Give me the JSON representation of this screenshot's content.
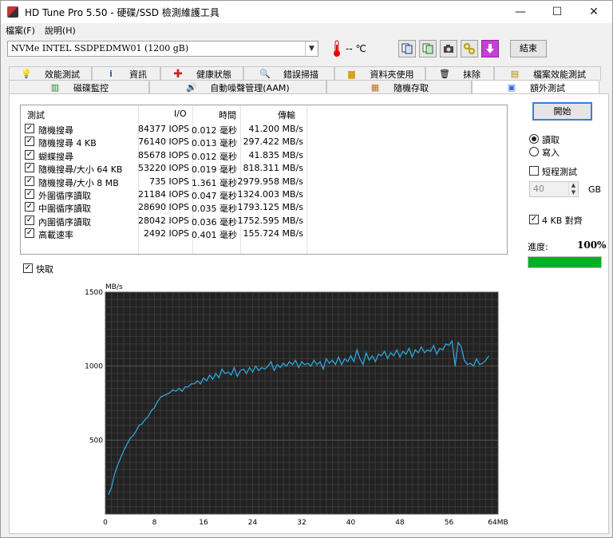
{
  "window": {
    "title": "HD Tune Pro 5.50 - 硬碟/SSD 檢測維護工具",
    "minimize": "—",
    "maximize": "☐",
    "close": "✕"
  },
  "menu": {
    "file": "檔案(F)",
    "help": "說明(H)"
  },
  "toolbar": {
    "drive": "NVMe   INTEL SSDPEDMW01 (1200 gB)",
    "temperature": "-- ℃",
    "exit_label": "結束"
  },
  "tabs_top": [
    {
      "label": "效能測試",
      "icon": "lightbulb-icon"
    },
    {
      "label": "資訊",
      "icon": "info-icon"
    },
    {
      "label": "健康狀態",
      "icon": "health-cross-icon"
    },
    {
      "label": "錯誤掃描",
      "icon": "magnifier-icon"
    },
    {
      "label": "資料夾使用",
      "icon": "folder-icon"
    },
    {
      "label": "抹除",
      "icon": "trash-icon"
    },
    {
      "label": "檔案效能測試",
      "icon": "file-benchmark-icon"
    }
  ],
  "tabs_bottom": [
    {
      "label": "磁碟監控",
      "icon": "monitor-icon"
    },
    {
      "label": "自動噪聲管理(AAM)",
      "icon": "speaker-icon"
    },
    {
      "label": "隨機存取",
      "icon": "random-access-icon"
    },
    {
      "label": "額外測試",
      "icon": "extra-tests-icon"
    }
  ],
  "results": {
    "headers": {
      "test": "測試",
      "io": "I/O",
      "time": "時間",
      "transfer": "傳輸"
    },
    "rows": [
      {
        "name": "隨機搜尋",
        "io": "84377 IOPS",
        "time": "0.012 毫秒",
        "transfer": "41.200 MB/s"
      },
      {
        "name": "隨機搜尋 4 KB",
        "io": "76140 IOPS",
        "time": "0.013 毫秒",
        "transfer": "297.422 MB/s"
      },
      {
        "name": "蝴蝶搜尋",
        "io": "85678 IOPS",
        "time": "0.012 毫秒",
        "transfer": "41.835 MB/s"
      },
      {
        "name": "隨機搜尋/大小 64 KB",
        "io": "53220 IOPS",
        "time": "0.019 毫秒",
        "transfer": "818.311 MB/s"
      },
      {
        "name": "隨機搜尋/大小 8 MB",
        "io": "735 IOPS",
        "time": "1.361 毫秒",
        "transfer": "2979.958 MB/s"
      },
      {
        "name": "外圍循序讀取",
        "io": "21184 IOPS",
        "time": "0.047 毫秒",
        "transfer": "1324.003 MB/s"
      },
      {
        "name": "中圍循序讀取",
        "io": "28690 IOPS",
        "time": "0.035 毫秒",
        "transfer": "1793.125 MB/s"
      },
      {
        "name": "內圍循序讀取",
        "io": "28042 IOPS",
        "time": "0.036 毫秒",
        "transfer": "1752.595 MB/s"
      },
      {
        "name": "高載速率",
        "io": "2492 IOPS",
        "time": "0.401 毫秒",
        "transfer": "155.724 MB/s"
      }
    ]
  },
  "side": {
    "start_label": "開始",
    "read_label": "讀取",
    "write_label": "寫入",
    "short_test_label": "短程測試",
    "size_value": "40",
    "size_unit": "GB",
    "align_label": "4 KB 對齊",
    "progress_label": "進度:",
    "progress_text": "100%",
    "progress_fraction": 1.0
  },
  "cache_label": "快取",
  "chart_data": {
    "type": "line",
    "ylabel": "MB/s",
    "xlim": [
      0,
      64
    ],
    "ylim": [
      0,
      1500
    ],
    "xticks": [
      "0",
      "8",
      "16",
      "24",
      "32",
      "40",
      "48",
      "56",
      "64MB"
    ],
    "yticks": [
      "500",
      "1000",
      "1500"
    ],
    "line_color": "#2aa7d8",
    "grid": true,
    "x": [
      0.5,
      1,
      1.5,
      2,
      2.5,
      3,
      3.5,
      4,
      4.5,
      5,
      5.5,
      6,
      6.5,
      7,
      7.5,
      8,
      8.5,
      9,
      9.5,
      10,
      10.5,
      11,
      11.5,
      12,
      12.5,
      13,
      13.5,
      14,
      14.5,
      15,
      15.5,
      16,
      16.5,
      17,
      17.5,
      18,
      18.5,
      19,
      19.5,
      20,
      20.5,
      21,
      21.5,
      22,
      22.5,
      23,
      23.5,
      24,
      24.5,
      25,
      25.5,
      26,
      26.5,
      27,
      27.5,
      28,
      28.5,
      29,
      29.5,
      30,
      30.5,
      31,
      31.5,
      32,
      32.5,
      33,
      33.5,
      34,
      34.5,
      35,
      35.5,
      36,
      36.5,
      37,
      37.5,
      38,
      38.5,
      39,
      39.5,
      40,
      40.5,
      41,
      41.5,
      42,
      42.5,
      43,
      43.5,
      44,
      44.5,
      45,
      45.5,
      46,
      46.5,
      47,
      47.5,
      48,
      48.5,
      49,
      49.5,
      50,
      50.5,
      51,
      51.5,
      52,
      52.5,
      53,
      53.5,
      54,
      54.5,
      55,
      55.5,
      56,
      56.5,
      57,
      57.5,
      58,
      58.5,
      59,
      59.5,
      60,
      60.5,
      61,
      61.5,
      62,
      62.5,
      63,
      63.5
    ],
    "y": [
      130,
      180,
      270,
      330,
      380,
      430,
      470,
      510,
      530,
      560,
      600,
      610,
      640,
      660,
      700,
      720,
      760,
      790,
      800,
      810,
      820,
      840,
      830,
      850,
      830,
      860,
      860,
      880,
      880,
      900,
      880,
      920,
      900,
      940,
      910,
      950,
      920,
      980,
      950,
      960,
      940,
      990,
      930,
      970,
      980,
      950,
      990,
      960,
      1000,
      970,
      990,
      980,
      1000,
      1030,
      970,
      1010,
      990,
      1020,
      1000,
      1030,
      1010,
      1040,
      990,
      1030,
      1010,
      1020,
      1000,
      1040,
      1010,
      1030,
      980,
      1050,
      1020,
      1040,
      1010,
      1060,
      1010,
      1050,
      1030,
      1070,
      1030,
      1110,
      1050,
      1010,
      1090,
      1040,
      1070,
      1030,
      1080,
      1070,
      1100,
      1050,
      1090,
      1070,
      1110,
      1060,
      1100,
      1080,
      1120,
      1060,
      1110,
      1090,
      1130,
      1090,
      1110,
      1100,
      1140,
      1080,
      1120,
      1110,
      1150,
      1140,
      1170,
      1000,
      1160,
      1130,
      1040,
      1010,
      1020,
      1000,
      1050,
      1010,
      1020,
      1040,
      1070
    ]
  }
}
